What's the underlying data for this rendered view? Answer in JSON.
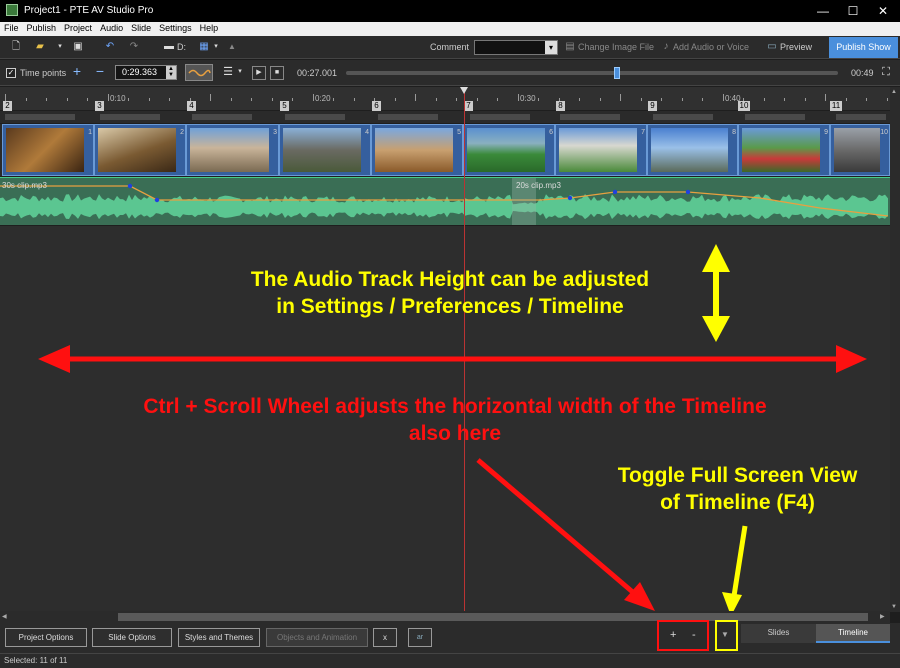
{
  "window": {
    "title": "Project1 - PTE AV Studio Pro",
    "controls": [
      "—",
      "☐",
      "✕"
    ]
  },
  "menu": [
    "File",
    "Publish",
    "Project",
    "Audio",
    "Slide",
    "Settings",
    "Help"
  ],
  "toolbar": {
    "drive_label": "D:",
    "comment_label": "Comment",
    "comment_value": "",
    "change_image_label": "Change Image File",
    "add_audio_label": "Add Audio or Voice",
    "preview_label": "Preview",
    "publish_label": "Publish Show"
  },
  "timeline_controls": {
    "time_points_label": "Time points",
    "time_points_checked": true,
    "time_value": "0:29.363",
    "current_time": "00:27.001",
    "total_time": "00:49",
    "seek_fraction": 0.55
  },
  "ruler": {
    "time_labels": [
      "0:10",
      "0:20",
      "0:30",
      "0:40"
    ],
    "slide_numbers": [
      "2",
      "3",
      "4",
      "5",
      "6",
      "7",
      "8",
      "9",
      "10",
      "11"
    ]
  },
  "slides": [
    {
      "num": "1"
    },
    {
      "num": "2"
    },
    {
      "num": "3"
    },
    {
      "num": "4"
    },
    {
      "num": "5"
    },
    {
      "num": "6"
    },
    {
      "num": "7"
    },
    {
      "num": "8"
    },
    {
      "num": "9"
    },
    {
      "num": "10"
    }
  ],
  "audio": {
    "clip1": "30s clip.mp3",
    "clip2": "20s clip.mp3"
  },
  "annotations": {
    "audio_height_line1": "The Audio Track Height can be adjusted",
    "audio_height_line2": "in Settings / Preferences / Timeline",
    "ctrl_scroll_line1": "Ctrl + Scroll Wheel adjusts the horizontal width of the Timeline",
    "ctrl_scroll_line2": "also here",
    "toggle_line1": "Toggle Full Screen View",
    "toggle_line2": "of Timeline (F4)"
  },
  "bottom": {
    "project_options": "Project Options",
    "slide_options": "Slide Options",
    "styles_themes": "Styles and Themes",
    "objects_animation": "Objects and Animation",
    "x_button": "x",
    "zoom_in": "+",
    "zoom_out": "-",
    "toggle_fullscreen": "▼",
    "tab_slides": "Slides",
    "tab_timeline": "Timeline"
  },
  "status": "Selected: 11 of 11",
  "colors": {
    "annotation_yellow": "#ffff00",
    "annotation_red": "#ff1010",
    "accent_blue": "#4a8fdc",
    "audio_green": "#3a6e55"
  }
}
